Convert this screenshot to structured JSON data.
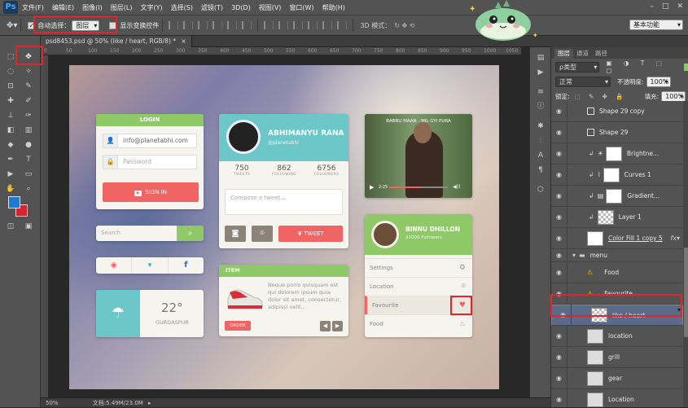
{
  "app": {
    "logo": "Ps"
  },
  "menubar": {
    "items": [
      "文件(F)",
      "编辑(E)",
      "图像(I)",
      "图层(L)",
      "文字(Y)",
      "选择(S)",
      "滤镜(T)",
      "3D(D)",
      "视图(V)",
      "窗口(W)",
      "帮助(H)"
    ],
    "window_controls": [
      "–",
      "□",
      "✕"
    ]
  },
  "options_bar": {
    "auto_select_label": "自动选择：",
    "auto_select_value": "图层",
    "show_transform_label": "显示变换控件",
    "mode_3d_label": "3D 模式：",
    "workspace": "基本功能"
  },
  "document_tab": {
    "title": "psd8453.psd @ 50% (like / heart, RGB/8) *",
    "close": "×"
  },
  "ruler_ticks": [
    "0",
    "50",
    "100",
    "150",
    "200",
    "250",
    "300",
    "350",
    "400",
    "450",
    "500",
    "550",
    "600",
    "650",
    "700",
    "750",
    "800",
    "850",
    "900",
    "950",
    "1000",
    "1050"
  ],
  "status": {
    "zoom": "50%",
    "doc": "文档:5.49M/23.0M",
    "arrow": "▸"
  },
  "login_card": {
    "title": "LOGIN",
    "email": "info@planetabhi.com",
    "password_placeholder": "Password",
    "signin": "SIGN IN"
  },
  "search_bar": {
    "placeholder": "Search"
  },
  "social_bar": {
    "icons": [
      "◉",
      "🐦",
      "f"
    ]
  },
  "weather_card": {
    "temp": "22°",
    "city": "GURDASPUR"
  },
  "profile_card": {
    "name": "ABHIMANYU RANA",
    "handle": "@planetabhi",
    "stats": [
      {
        "value": "750",
        "label": "TWEETS"
      },
      {
        "value": "862",
        "label": "FOLLOWING"
      },
      {
        "value": "6756",
        "label": "FOLLOWERS"
      }
    ],
    "compose_placeholder": "Compose a tweet...",
    "tweet_button": "TWEET"
  },
  "item_card": {
    "header": "ITEM",
    "description": "Neque porro quisquam est qui dolorem ipsum quia dolor sit amet, consectetur, adipisci velit...",
    "order_button": "ORDER"
  },
  "video_card": {
    "caption": "BABBU MAAN - MIL GYI PURA",
    "time": "2:25"
  },
  "menu_card": {
    "name": "BINNU DHILLON",
    "followers": "22000 Followers",
    "items": [
      {
        "label": "Settings",
        "icon": "⚙"
      },
      {
        "label": "Location",
        "icon": "⌾"
      },
      {
        "label": "Favourite",
        "icon": "♥"
      },
      {
        "label": "Food",
        "icon": "♨"
      }
    ]
  },
  "panels": {
    "tabs": [
      "图层",
      "通道",
      "路径"
    ],
    "kind_label": "ρ类型",
    "blend_mode": "正常",
    "opacity_label": "不透明度:",
    "opacity_value": "100%",
    "lock_label": "锁定:",
    "fill_label": "填充:",
    "fill_value": "100%",
    "layers": [
      {
        "name": "Shape 29 copy",
        "type": "shape"
      },
      {
        "name": "Shape 29",
        "type": "shape"
      },
      {
        "name": "Brightne...",
        "type": "adj"
      },
      {
        "name": "Curves 1",
        "type": "adj"
      },
      {
        "name": "Gradient...",
        "type": "adj"
      },
      {
        "name": "Layer 1",
        "type": "pixel"
      },
      {
        "name": "Color Fill 1 copy 5",
        "type": "fill"
      },
      {
        "name": "menu",
        "type": "group"
      },
      {
        "name": "Food",
        "type": "smart"
      },
      {
        "name": "Favourite",
        "type": "smart"
      },
      {
        "name": "like / heart",
        "type": "selected"
      },
      {
        "name": "location",
        "type": "smart"
      },
      {
        "name": "grill",
        "type": "smart"
      },
      {
        "name": "gear",
        "type": "smart"
      },
      {
        "name": "Location",
        "type": "smart"
      }
    ]
  }
}
